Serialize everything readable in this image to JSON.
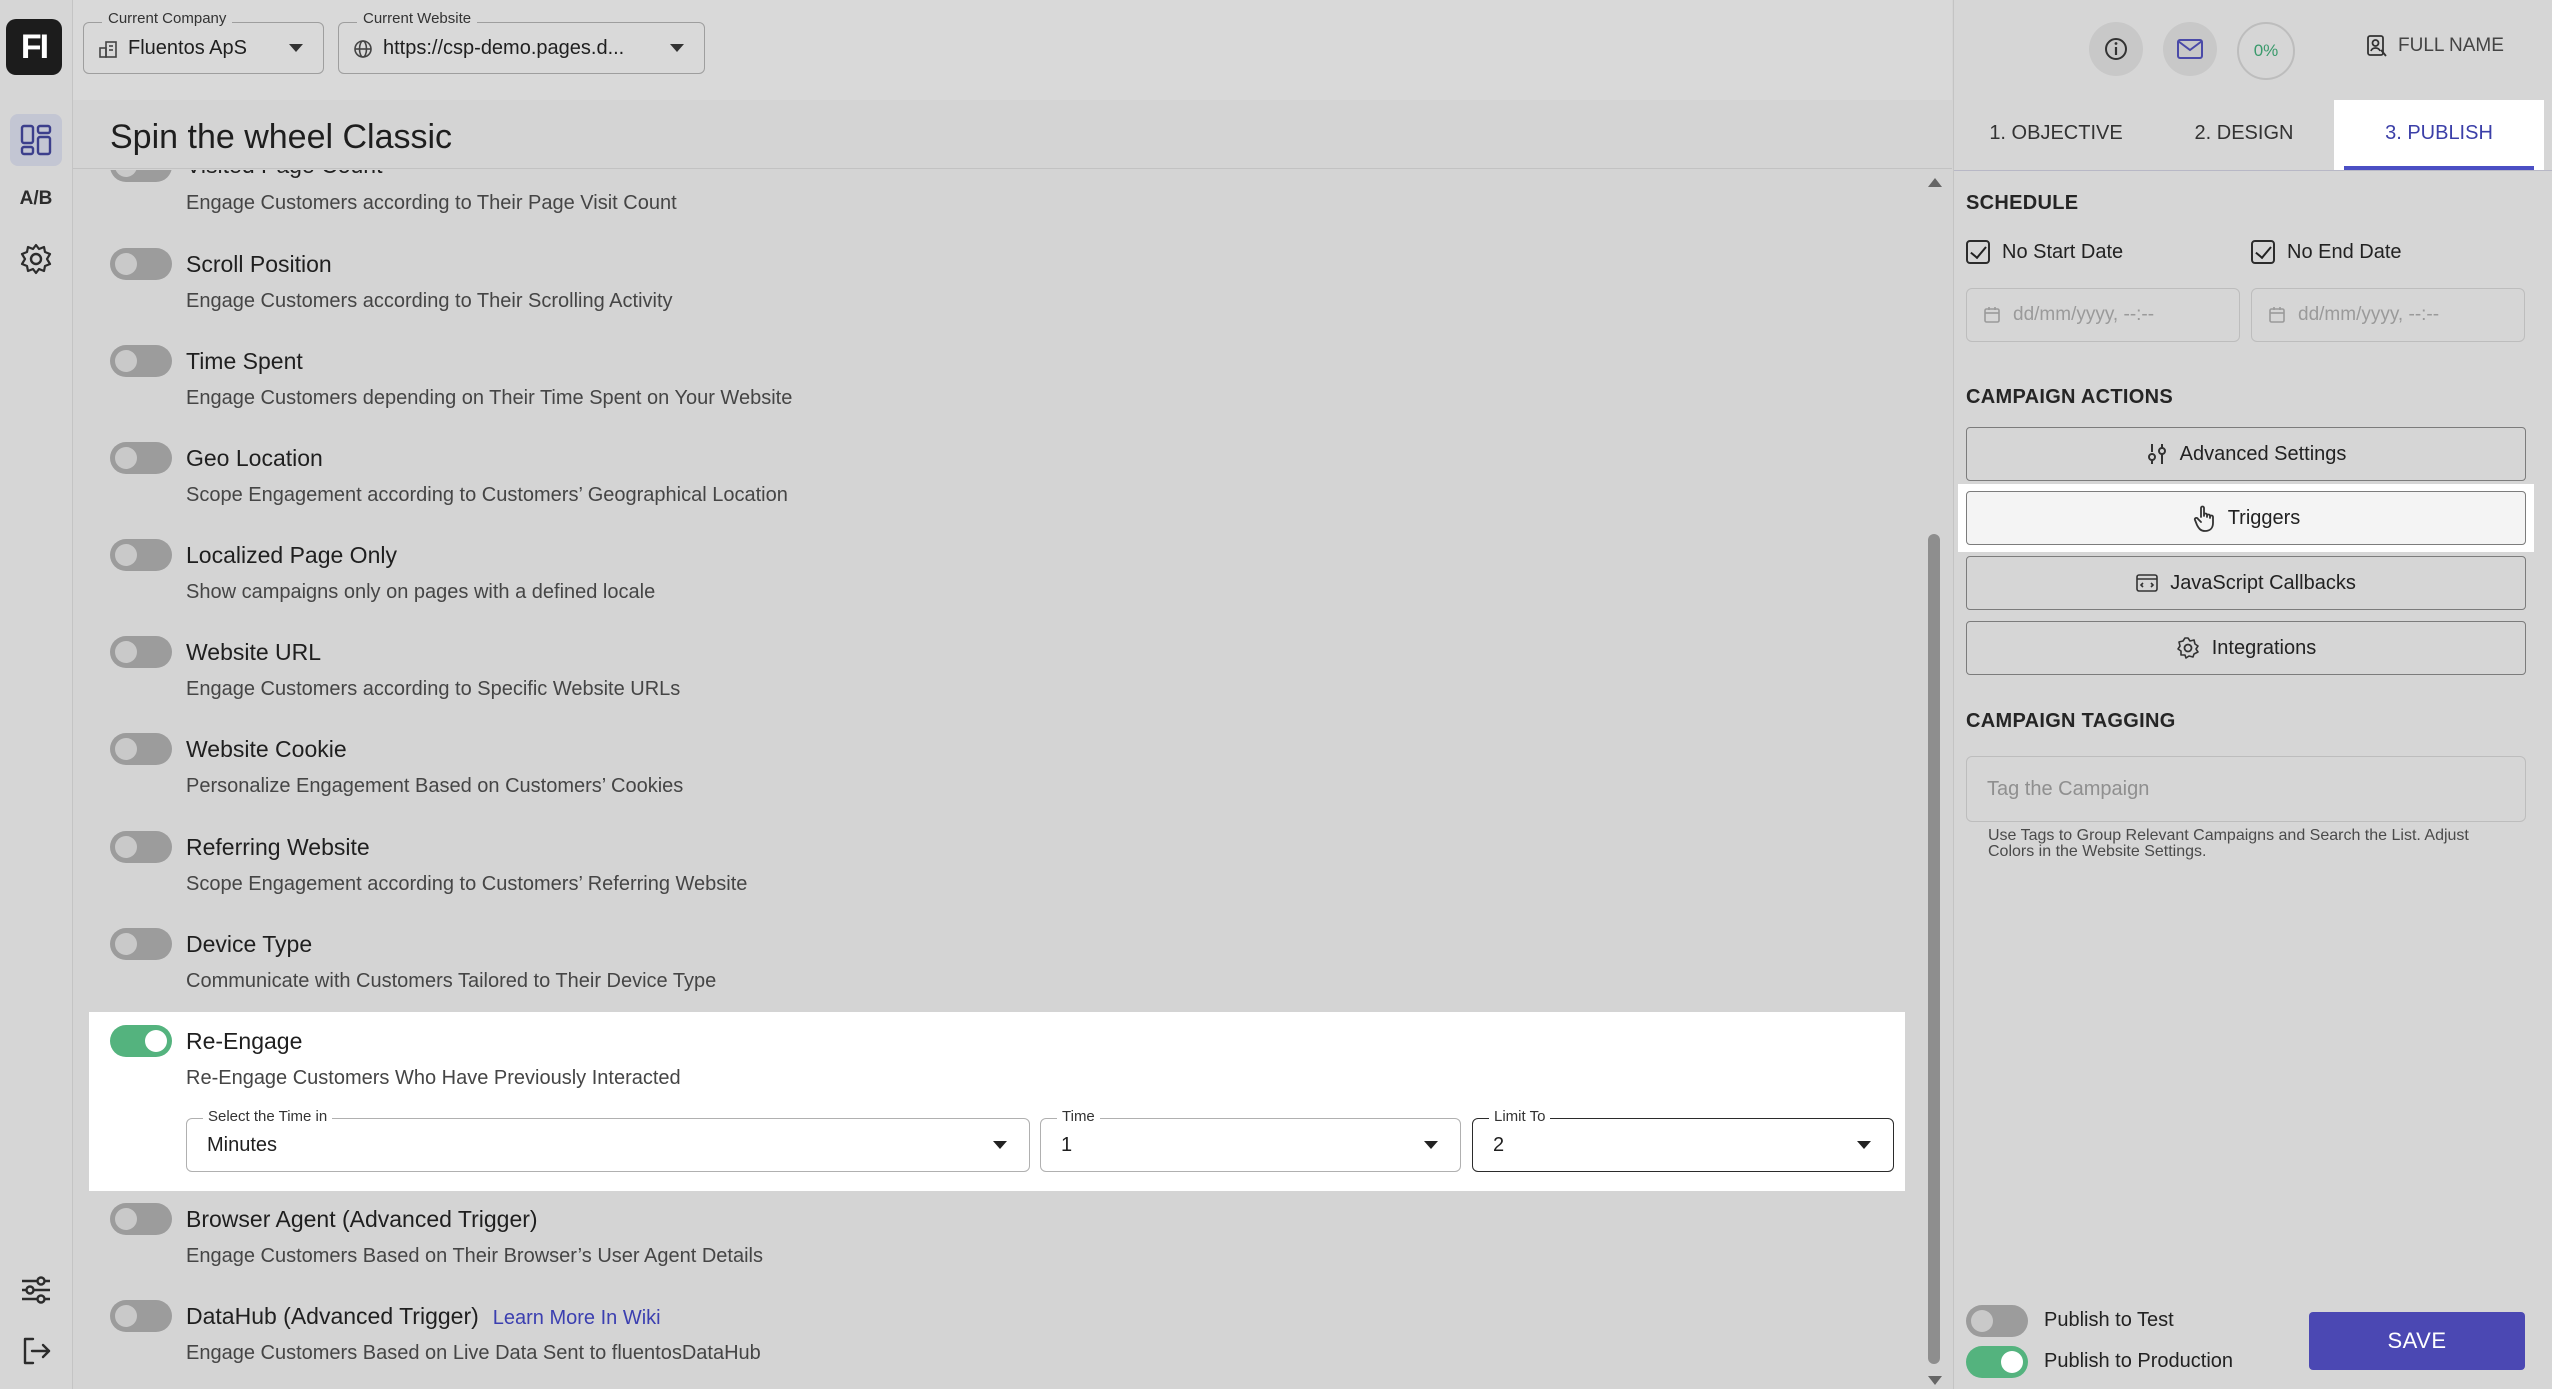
{
  "app": {
    "logo_text": "FI"
  },
  "rail": {
    "ab_label": "A/B"
  },
  "header": {
    "company": {
      "label": "Current Company",
      "value": "Fluentos ApS"
    },
    "website": {
      "label": "Current Website",
      "value": "https://csp-demo.pages.d..."
    }
  },
  "page_title": "Spin the wheel Classic",
  "triggers": [
    {
      "name": "Visited Page Count",
      "desc": "Engage Customers according to Their Page Visit Count",
      "on": false
    },
    {
      "name": "Scroll Position",
      "desc": "Engage Customers according to Their Scrolling Activity",
      "on": false
    },
    {
      "name": "Time Spent",
      "desc": "Engage Customers depending on Their Time Spent on Your Website",
      "on": false
    },
    {
      "name": "Geo Location",
      "desc": "Scope Engagement according to Customers’ Geographical Location",
      "on": false
    },
    {
      "name": "Localized Page Only",
      "desc": "Show campaigns only on pages with a defined locale",
      "on": false
    },
    {
      "name": "Website URL",
      "desc": "Engage Customers according to Specific Website URLs",
      "on": false
    },
    {
      "name": "Website Cookie",
      "desc": "Personalize Engagement Based on Customers’ Cookies",
      "on": false
    },
    {
      "name": "Referring Website",
      "desc": "Scope Engagement according to Customers’ Referring Website",
      "on": false
    },
    {
      "name": "Device Type",
      "desc": "Communicate with Customers Tailored to Their Device Type",
      "on": false
    },
    {
      "name": "Re-Engage",
      "desc": "Re-Engage Customers Who Have Previously Interacted",
      "on": true
    },
    {
      "name": "Browser Agent (Advanced Trigger)",
      "desc": "Engage Customers Based on Their Browser’s User Agent Details",
      "on": false
    },
    {
      "name": "DataHub (Advanced Trigger)",
      "desc": "Engage Customers Based on Live Data Sent to fluentosDataHub",
      "on": false,
      "link": "Learn More In Wiki"
    }
  ],
  "reengage": {
    "time_unit": {
      "label": "Select the Time in",
      "value": "Minutes"
    },
    "time": {
      "label": "Time",
      "value": "1"
    },
    "limit": {
      "label": "Limit To",
      "value": "2"
    }
  },
  "right": {
    "progress": "0%",
    "user": "FULL NAME",
    "tabs": [
      "1. OBJECTIVE",
      "2. DESIGN",
      "3. PUBLISH"
    ],
    "active_tab": 2,
    "schedule": {
      "title": "SCHEDULE",
      "no_start": "No Start Date",
      "no_end": "No End Date",
      "date_placeholder": "dd/mm/yyyy, --:--"
    },
    "actions": {
      "title": "CAMPAIGN ACTIONS",
      "advanced": "Advanced Settings",
      "triggers": "Triggers",
      "js": "JavaScript Callbacks",
      "integrations": "Integrations"
    },
    "tagging": {
      "title": "CAMPAIGN TAGGING",
      "placeholder": "Tag the Campaign",
      "help": "Use Tags to Group Relevant Campaigns and Search the List. Adjust Colors in the Website Settings."
    },
    "publish": {
      "test": "Publish to Test",
      "test_on": false,
      "prod": "Publish to Production",
      "prod_on": true
    },
    "save": "SAVE"
  },
  "colors": {
    "accent": "#4b48b3",
    "toggle_on": "#54b37e",
    "progress": "#3a9a6c"
  }
}
